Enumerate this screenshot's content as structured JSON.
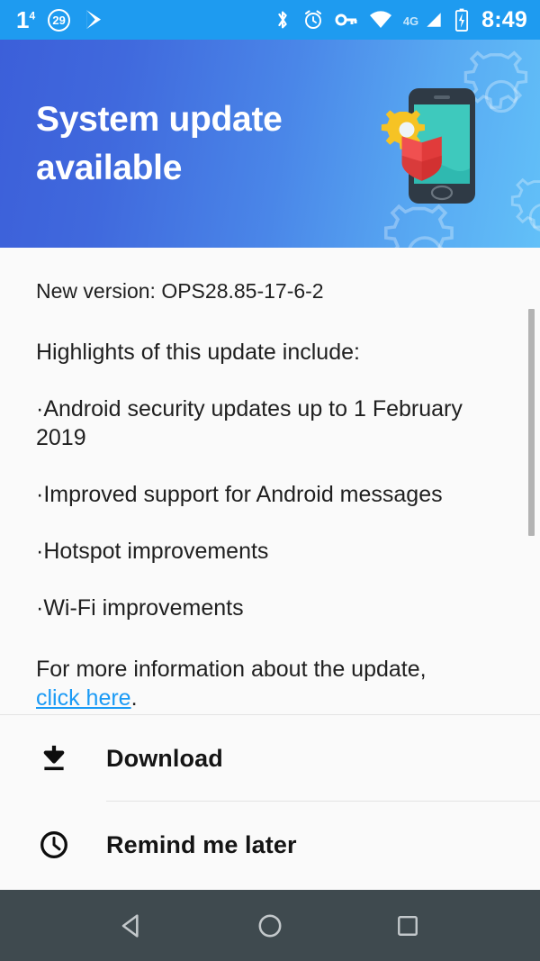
{
  "status_bar": {
    "sim_label": "1",
    "sim_superscript": "4",
    "notification_count": "29",
    "play_store_icon": "play-store-icon",
    "bluetooth_icon": "bluetooth-icon",
    "alarm_icon": "alarm-icon",
    "vpn_key_icon": "vpn-key-icon",
    "wifi_icon": "wifi-icon",
    "network_type": "4G",
    "signal_icon": "cellular-signal-icon",
    "battery_icon": "battery-charging-icon",
    "time": "8:49",
    "background_color": "#1e9bf0"
  },
  "hero": {
    "title": "System update available",
    "illustration_name": "phone-security-update-illustration",
    "gradient_from": "#3c5fd9",
    "gradient_to": "#62c0f8"
  },
  "content": {
    "version_line": "New version: OPS28.85-17-6-2",
    "highlights_heading": "Highlights of this update include:",
    "bullets": [
      "·Android security updates up to 1 February 2019",
      "·Improved support for Android messages",
      "·Hotspot improvements",
      "·Wi-Fi improvements"
    ],
    "more_info_prefix": "For more information about the update,",
    "link_text": "click here",
    "more_info_suffix": ".",
    "link_color": "#1a9af5"
  },
  "actions": [
    {
      "label": "Download",
      "icon": "download-icon"
    },
    {
      "label": "Remind me later",
      "icon": "clock-icon"
    }
  ],
  "nav_bar": {
    "back": "back-nav-button",
    "home": "home-nav-button",
    "recents": "recents-nav-button",
    "background_color": "#3f4a4f"
  }
}
